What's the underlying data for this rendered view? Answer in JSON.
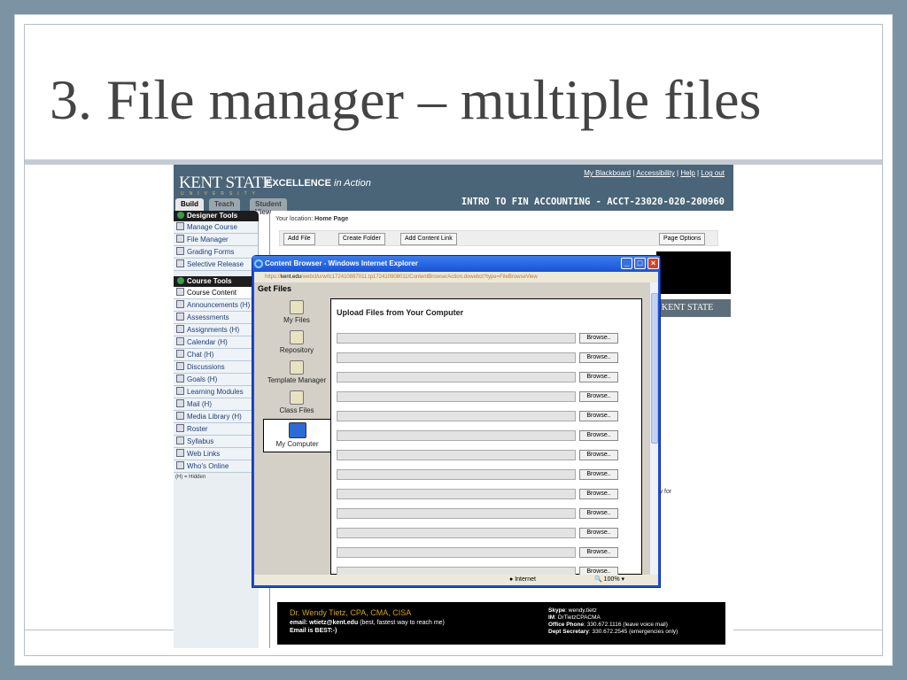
{
  "slide": {
    "title": "3.  File manager – multiple files"
  },
  "header": {
    "logo": "KENT STATE",
    "logo_sub": "UNIVERSITY",
    "slogan_bold": "EXCELLENCE",
    "slogan_italic": "in Action",
    "links": [
      "My Blackboard",
      "Accessibility",
      "Help",
      "Log out"
    ],
    "course": "INTRO TO FIN ACCOUNTING - ACCT-23020-020-200960",
    "tabs": [
      "Build",
      "Teach",
      "Student View"
    ]
  },
  "sidebar": {
    "designer_title": "Designer Tools",
    "designer_items": [
      "Manage Course",
      "File Manager",
      "Grading Forms",
      "Selective Release"
    ],
    "course_title": "Course Tools",
    "course_items": [
      "Course Content",
      "Announcements (H)",
      "Assessments",
      "Assignments (H)",
      "Calendar (H)",
      "Chat (H)",
      "Discussions",
      "Goals (H)",
      "Learning Modules",
      "Mail (H)",
      "Media Library (H)",
      "Roster",
      "Syllabus",
      "Web Links",
      "Who's Online"
    ],
    "hidden_note": "(H) = Hidden"
  },
  "content": {
    "location_label": "Your location:",
    "location_value": "Home Page",
    "toolbar": [
      "Add File",
      "Create Folder",
      "Add Content Link",
      "Page Options"
    ],
    "ks_mini": "KENT STATE",
    "frag_for": "w for"
  },
  "footer": {
    "name": "Dr. Wendy Tietz, CPA, CMA, CISA",
    "email_label": "email: wtietz@kent.edu",
    "email_note": "(best, fastest way to reach me)",
    "best": "Email is BEST:-)",
    "skype_label": "Skype",
    "skype_value": ": wendy.tietz",
    "im_label": "IM",
    "im_value": ": DrTietzCPACMA",
    "office_label": "Office Phone",
    "office_value": ": 330.672.1116 (leave voice mail)",
    "dept_label": "Dept Secretary",
    "dept_value": ": 330.672.2545 (emergencies only)"
  },
  "dialog": {
    "title": "Content Browser - Windows Internet Explorer",
    "address_prefix": "https://",
    "address_host": "kent.edu",
    "address_rest": "/webct/urw/lc172410887011.tp172410908011/ContentBrowserAction.dowebct?type=FileBrowseView",
    "get_files": "Get Files",
    "sources": [
      "My Files",
      "Repository",
      "Template Manager",
      "Class Files",
      "My Computer"
    ],
    "upload_title": "Upload Files from Your Computer",
    "browse_label": "Browse..",
    "status_zone": "Internet",
    "zoom": "100%"
  }
}
